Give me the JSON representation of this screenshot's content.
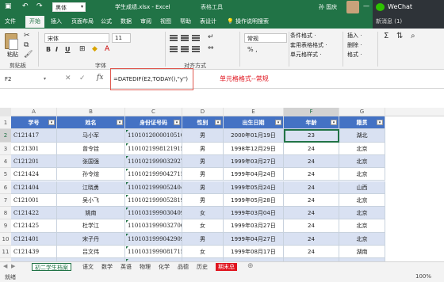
{
  "titlebar": {
    "font_name": "黑体",
    "title": "学生成绩.xlsx  -  Excel",
    "context_tools": "表格工具",
    "user": "孙 国庆",
    "undo": "↶",
    "redo": "↷",
    "save": "▣",
    "minimize": "—",
    "restore": "▢",
    "close": "✕"
  },
  "tabs": {
    "items": [
      "文件",
      "开始",
      "插入",
      "页面布局",
      "公式",
      "数据",
      "审阅",
      "视图",
      "帮助",
      "表设计"
    ],
    "active": "开始",
    "tell_me": "操作说明搜索"
  },
  "wechat": {
    "name": "WeChat",
    "message": "新消息 (1)"
  },
  "ribbon": {
    "paste": "粘贴",
    "clipboard": "剪贴板",
    "font_group": "字体",
    "align_group": "对齐方式",
    "font_name": "宋体",
    "font_size": "11",
    "bold": "B",
    "italic": "I",
    "underline": "U",
    "number_format": "常规",
    "cond_format": "条件格式 ·",
    "table_format": "套用表格格式 ·",
    "cell_style": "单元格样式 ·",
    "insert": "插入 ·",
    "delete": "删除 ·",
    "format": "格式 ·",
    "percent": "% ,",
    "icons": [
      "cut-icon",
      "copy-icon",
      "format-painter-icon",
      "sum-icon",
      "sort-icon",
      "find-icon"
    ]
  },
  "formula_bar": {
    "name_box": "F2",
    "cancel": "✕",
    "enter": "✓",
    "fx": "fx",
    "formula": "=DATEDIF(E2,TODAY(),\"y\")",
    "annotation": "单元格格式--常规"
  },
  "columns": [
    "A",
    "B",
    "C",
    "D",
    "E",
    "F",
    "G"
  ],
  "headers": [
    "学号",
    "姓名",
    "身份证号码",
    "性别",
    "出生日期",
    "年龄",
    "籍贯"
  ],
  "rows": [
    [
      "C121417",
      "马小军",
      "110101200001051054",
      "男",
      "2000年01月19日",
      "23",
      "湖北"
    ],
    [
      "C121301",
      "曾令铨",
      "110102199812191513",
      "男",
      "1998年12月29日",
      "24",
      "北京"
    ],
    [
      "C121201",
      "张国强",
      "110102199903292713",
      "男",
      "1999年03月27日",
      "24",
      "北京"
    ],
    [
      "C121424",
      "孙令煊",
      "110102199904271532",
      "男",
      "1999年04月24日",
      "24",
      "北京"
    ],
    [
      "C121404",
      "江晓勇",
      "110102199905240451",
      "男",
      "1999年05月24日",
      "24",
      "山西"
    ],
    [
      "C121001",
      "吴小飞",
      "110102199905281913",
      "男",
      "1999年05月28日",
      "24",
      "北京"
    ],
    [
      "C121422",
      "姚南",
      "110103199903040920",
      "女",
      "1999年03月04日",
      "24",
      "北京"
    ],
    [
      "C121425",
      "杜学江",
      "110103199903270623",
      "女",
      "1999年03月27日",
      "24",
      "北京"
    ],
    [
      "C121401",
      "宋子丹",
      "110103199904290936",
      "男",
      "1999年04月27日",
      "24",
      "北京"
    ],
    [
      "C121439",
      "吕文伟",
      "110103199908171548",
      "女",
      "1999年08月17日",
      "24",
      "湖南"
    ],
    [
      "C120802",
      "符坚",
      "110104199810261737",
      "男",
      "1998年10月26日",
      "24",
      "山西"
    ]
  ],
  "row_numbers": [
    "1",
    "2",
    "3",
    "4",
    "5",
    "6",
    "7",
    "8",
    "9",
    "10",
    "11",
    "12"
  ],
  "sheet_tabs": [
    "初二学生档案",
    "语文",
    "数学",
    "英语",
    "物理",
    "化学",
    "品德",
    "历史",
    "期末总"
  ],
  "active_sheet": "初二学生档案",
  "status": {
    "left": "就绪",
    "zoom": "100%"
  },
  "colors": {
    "excel_green": "#217346",
    "header_blue": "#4472c4",
    "band": "#d9e1f2",
    "annotation_red": "#e0141e"
  }
}
